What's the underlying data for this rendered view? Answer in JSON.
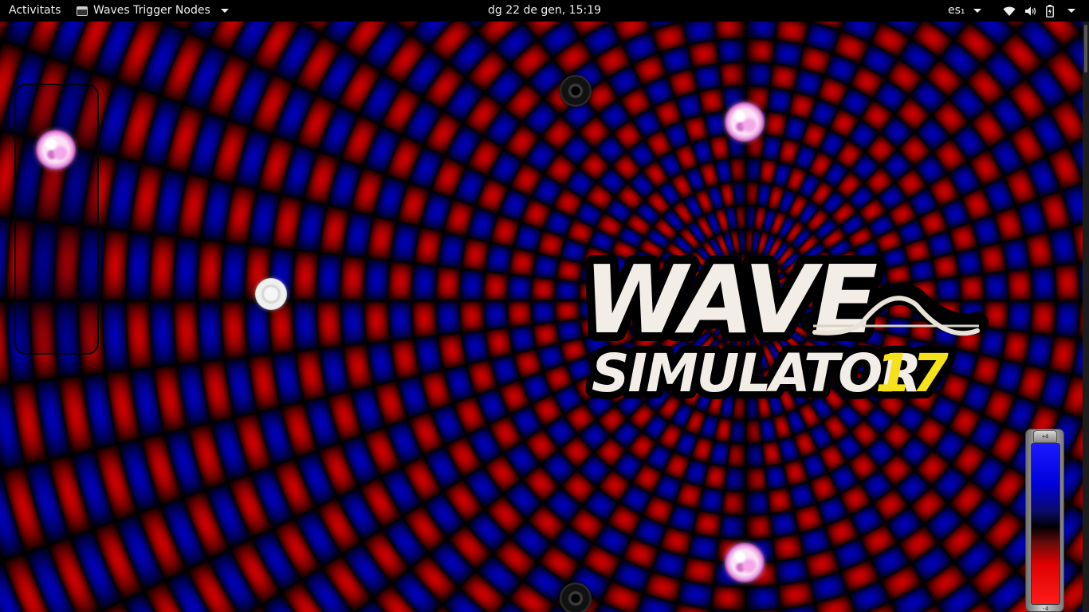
{
  "topbar": {
    "activities": "Activitats",
    "app_name": "Waves Trigger Nodes",
    "clock": "dg 22 de gen, 15:19",
    "keyboard_layout": "es₁",
    "icons": [
      "wifi-icon",
      "volume-icon",
      "battery-icon",
      "system-menu-icon"
    ]
  },
  "logo": {
    "line1": "WAVE",
    "line2": "SIMULATOR",
    "number": "17"
  },
  "meter": {
    "top_label": "+4",
    "bottom_label": "-4"
  },
  "colors": {
    "wave_positive": "#c00000",
    "wave_negative": "#0000b4",
    "logo_text": "#f2ede6",
    "logo_number": "#f5e21a"
  }
}
